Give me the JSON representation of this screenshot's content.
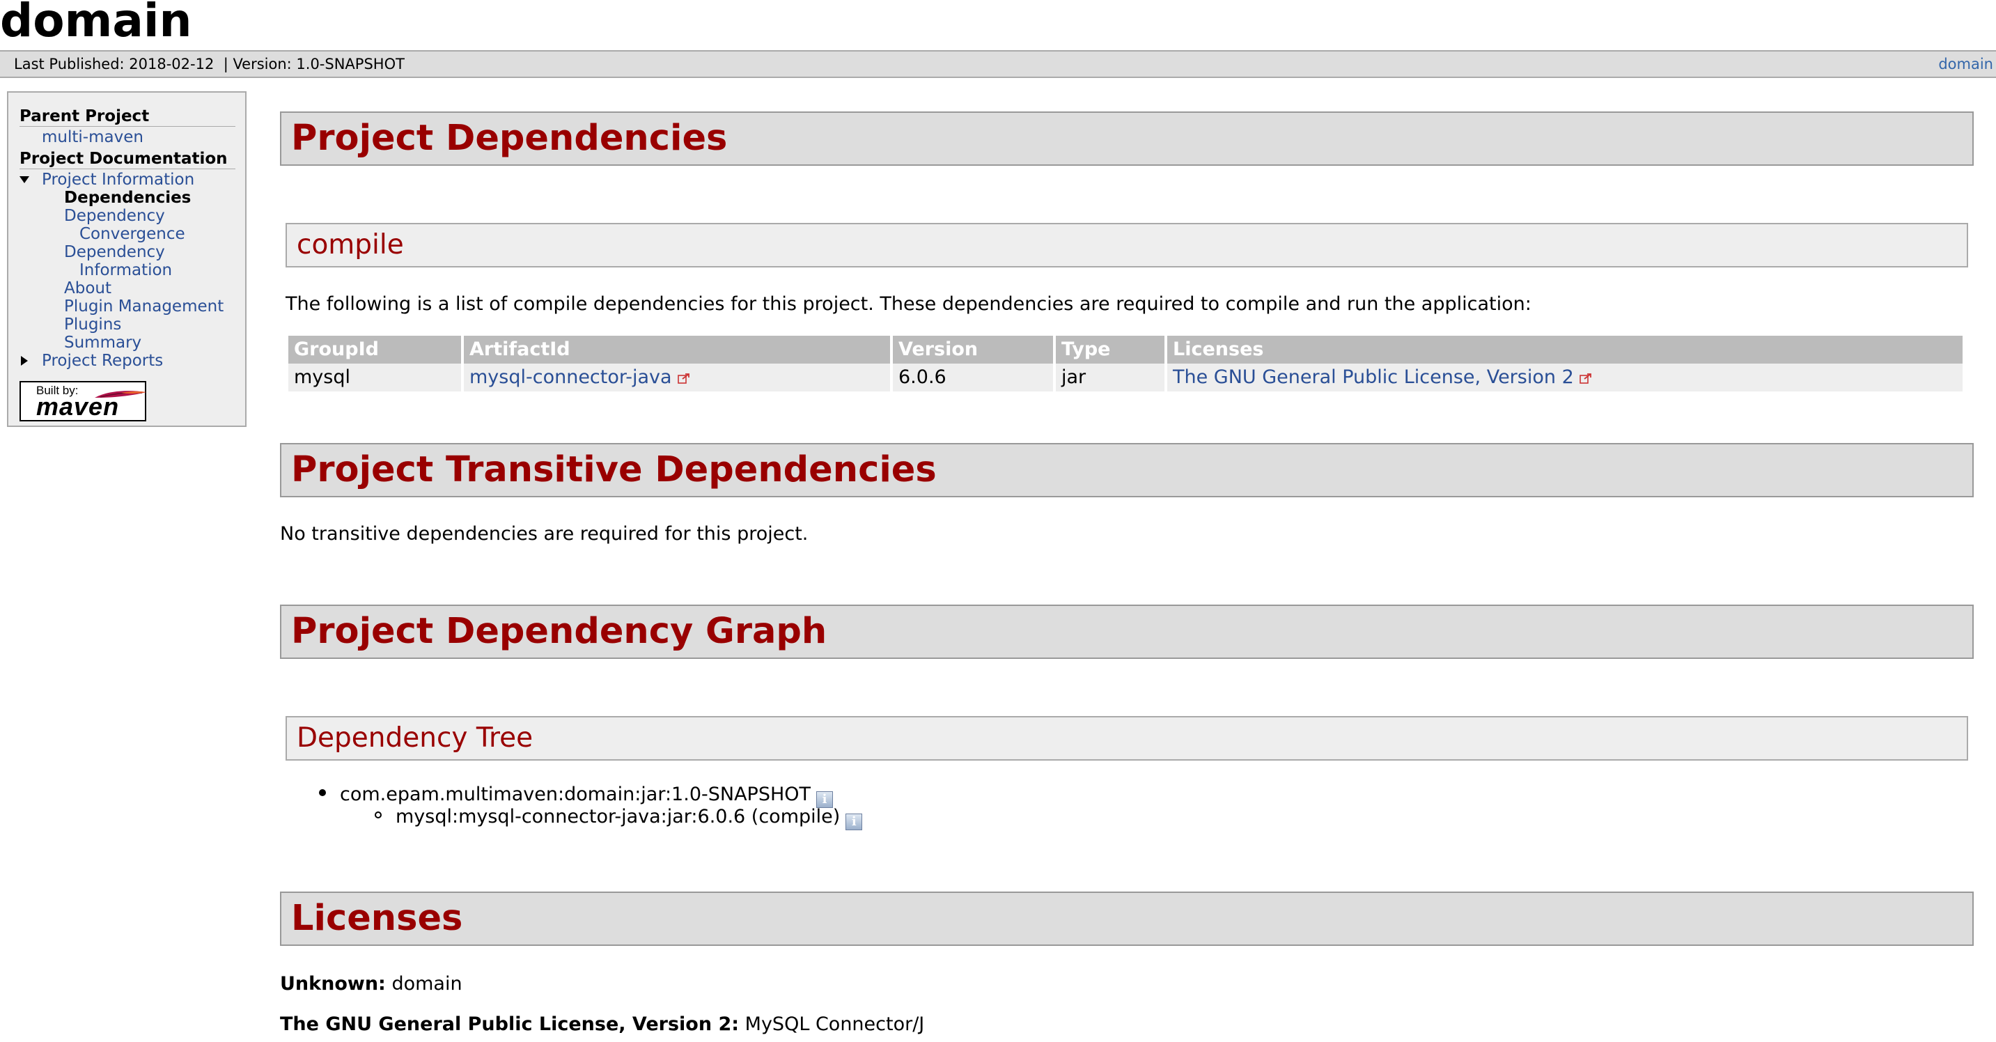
{
  "banner": {
    "title": "domain"
  },
  "breadcrumbs": {
    "last_published": "Last Published: 2018-02-12",
    "version": "| Version: 1.0-SNAPSHOT",
    "right_link": "domain"
  },
  "nav": {
    "parent_heading": "Parent Project",
    "parent_link": "multi-maven",
    "docs_heading": "Project Documentation",
    "project_information": "Project Information",
    "items": [
      {
        "label": "Dependencies",
        "active": true
      },
      {
        "label": "Dependency",
        "label2": "Convergence"
      },
      {
        "label": "Dependency",
        "label2": "Information"
      },
      {
        "label": "About"
      },
      {
        "label": "Plugin Management"
      },
      {
        "label": "Plugins"
      },
      {
        "label": "Summary"
      }
    ],
    "project_reports": "Project Reports",
    "powered_by": {
      "built_by": "Built by:",
      "name": "maven"
    }
  },
  "sections": {
    "project_dependencies": "Project Dependencies",
    "compile_heading": "compile",
    "compile_text": "The following is a list of compile dependencies for this project. These dependencies are required to compile and run the application:",
    "table": {
      "headers": [
        "GroupId",
        "ArtifactId",
        "Version",
        "Type",
        "Licenses"
      ],
      "rows": [
        {
          "group": "mysql",
          "artifact": "mysql-connector-java",
          "version": "6.0.6",
          "type": "jar",
          "license": "The GNU General Public License, Version 2"
        }
      ]
    },
    "transitive_heading": "Project Transitive Dependencies",
    "transitive_text": "No transitive dependencies are required for this project.",
    "graph_heading": "Project Dependency Graph",
    "tree_heading": "Dependency Tree",
    "tree": {
      "root": "com.epam.multimaven:domain:jar:1.0-SNAPSHOT",
      "child": "mysql:mysql-connector-java:jar:6.0.6 (compile)"
    },
    "licenses_heading": "Licenses",
    "licenses": [
      {
        "name": "Unknown:",
        "value": "domain"
      },
      {
        "name": "The GNU General Public License, Version 2:",
        "value": "MySQL Connector/J"
      }
    ]
  },
  "colors": {
    "heading_red": "#990000",
    "link_blue": "#2a4f96",
    "header_gray": "#dddddd"
  }
}
